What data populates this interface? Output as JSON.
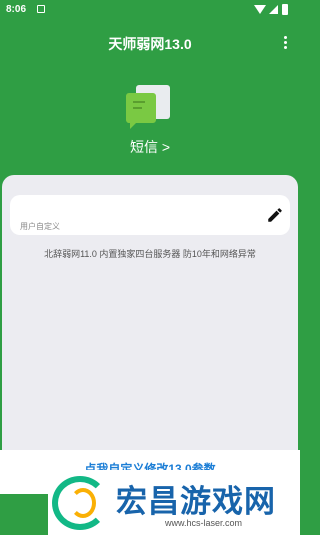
{
  "status_bar": {
    "time": "8:06"
  },
  "app_bar": {
    "title": "天师弱网13.0"
  },
  "sms": {
    "label": "短信 >"
  },
  "custom_input": {
    "value": "",
    "label": "用户自定义"
  },
  "info": {
    "text": "北辞弱网11.0 内置独家四台服务器 防10年和网络异常"
  },
  "bottom": {
    "label": "点我自定义修改13.0参数"
  },
  "watermark": {
    "title": "宏昌游戏网",
    "url": "www.hcs-laser.com"
  },
  "colors": {
    "primary_green": "#2f9e44",
    "panel_background": "#ececf1",
    "sms_icon_green": "#7ac943",
    "watermark_blue": "#1864ab"
  }
}
